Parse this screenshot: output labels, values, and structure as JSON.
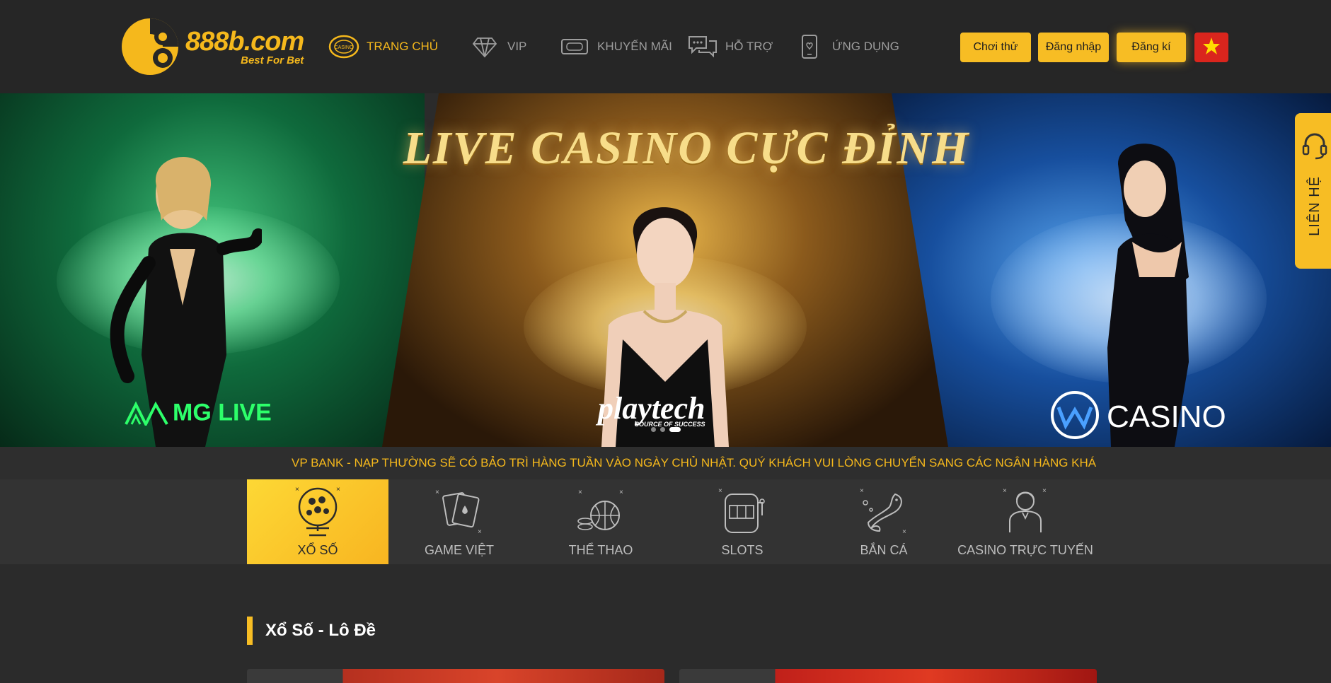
{
  "header": {
    "logo": {
      "domain": "888b.com",
      "tagline": "Best For Bet"
    },
    "nav": [
      {
        "label": "TRANG CHỦ",
        "icon": "casino-chip-icon",
        "active": true
      },
      {
        "label": "VIP",
        "icon": "diamond-icon",
        "active": false
      },
      {
        "label": "KHUYẾN MÃI",
        "icon": "ticket-icon",
        "active": false
      },
      {
        "label": "HỖ TRỢ",
        "icon": "chat-icon",
        "active": false
      },
      {
        "label": "ỨNG DỤNG",
        "icon": "phone-icon",
        "active": false
      }
    ],
    "buttons": {
      "trial": "Chơi thử",
      "login": "Đăng nhập",
      "register": "Đăng kí"
    },
    "language_icon": "vietnam-flag-icon"
  },
  "banner": {
    "title": "LIVE CASINO CỰC ĐỈNH",
    "brands": {
      "left": "MG LIVE",
      "middle": "playtech",
      "middle_sub": "SOURCE OF SUCCESS",
      "right": "CASINO"
    },
    "slide_count": 3,
    "active_slide": 3
  },
  "contact": {
    "label": "LIÊN HỆ",
    "icon": "headset-icon"
  },
  "notice": "VP BANK - NẠP THƯỜNG SẼ CÓ BẢO TRÌ HÀNG TUẦN VÀO NGÀY CHỦ NHẬT. QUÝ KHÁCH VUI LÒNG CHUYỂN SANG CÁC NGÂN HÀNG KHÁC THAY T",
  "categories": [
    {
      "label": "XỔ SỐ",
      "icon": "lottery-ball-icon",
      "active": true
    },
    {
      "label": "GAME VIỆT",
      "icon": "playing-cards-icon",
      "active": false
    },
    {
      "label": "THỂ THAO",
      "icon": "basketball-icon",
      "active": false
    },
    {
      "label": "SLOTS",
      "icon": "slot-machine-icon",
      "active": false
    },
    {
      "label": "BẮN CÁ",
      "icon": "fish-icon",
      "active": false
    },
    {
      "label": "CASINO TRỰC TUYẾN",
      "icon": "dealer-icon",
      "active": false
    }
  ],
  "section": {
    "title": "Xổ Số - Lô Đề"
  },
  "colors": {
    "accent": "#f7bd24",
    "header_bg": "#262626",
    "page_bg": "#2b2b2b",
    "flag_red": "#da251d"
  }
}
